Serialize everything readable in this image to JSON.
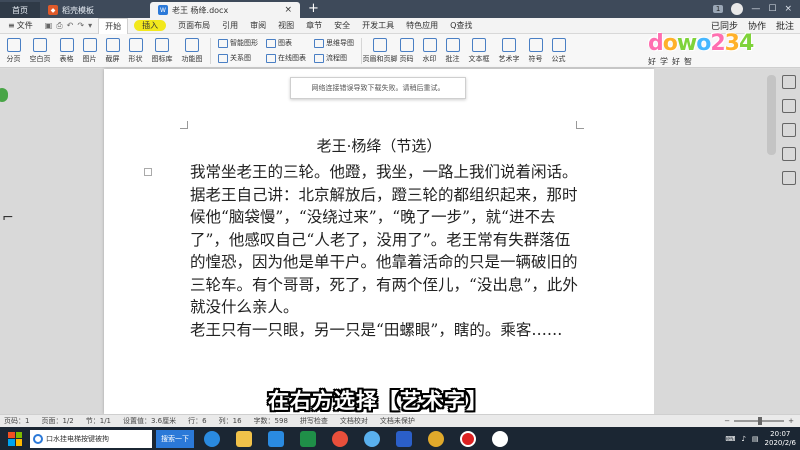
{
  "tabs": [
    {
      "label": "首页"
    },
    {
      "label": "稻壳模板"
    },
    {
      "label": "老王 杨绛.docx",
      "badge": "W"
    }
  ],
  "window": {
    "page_badge": "1"
  },
  "menu": {
    "file": "文件",
    "items": [
      "开始",
      "插入",
      "页面布局",
      "引用",
      "审阅",
      "视图",
      "章节",
      "安全",
      "开发工具",
      "特色应用"
    ],
    "search": "Q查找",
    "right": [
      "已同步",
      "协作",
      "批注"
    ]
  },
  "ribbon": {
    "big_left": [
      "分页",
      "空白页",
      "表格",
      "图片",
      "截屏",
      "形状",
      "图标库",
      "功能图"
    ],
    "small_groups": [
      [
        "智能图形",
        "关系图"
      ],
      [
        "图表",
        "在线图表"
      ],
      [
        "思维导图",
        "流程图"
      ]
    ],
    "big_right": [
      "页眉和页脚",
      "页码",
      "水印",
      "批注",
      "文本框",
      "艺术字",
      "符号",
      "公式"
    ]
  },
  "logo": {
    "text": "dowo234",
    "sub": "好学好智"
  },
  "toast": "网络连接错误导致下载失败。请稍后重试。",
  "document": {
    "title": "老王·杨绛（节选）",
    "paragraphs": [
      "我常坐老王的三轮。他蹬，我坐，一路上我们说着闲话。",
      "据老王自己讲：北京解放后，蹬三轮的都组织起来，那时候他“脑袋慢”，“没绕过来”，“晚了一步”，就“进不去了”，他感叹自己“人老了，没用了”。老王常有失群落伍的惶恐，因为他是单干户。他靠着活命的只是一辆破旧的三轮车。有个哥哥，死了，有两个侄儿，“没出息”，此外就没什么亲人。",
      "老王只有一只眼，另一只是“田螺眼”，瞎的。乘客……"
    ]
  },
  "caption": "在右方选择【艺术字】",
  "status": {
    "page_num": "页码：1",
    "pages": "页面：1/2",
    "section": "节：1/1",
    "setting": "设置值：3.6厘米",
    "row": "行：6",
    "col": "列：16",
    "words": "字数：598",
    "spell": "拼写检查",
    "proof": "文档校对",
    "protect": "文档未保护"
  },
  "taskbar": {
    "search_text": "口水挂电梯按键被拘",
    "search_btn": "搜索一下",
    "time": "20:07",
    "date": "2020/2/6"
  }
}
